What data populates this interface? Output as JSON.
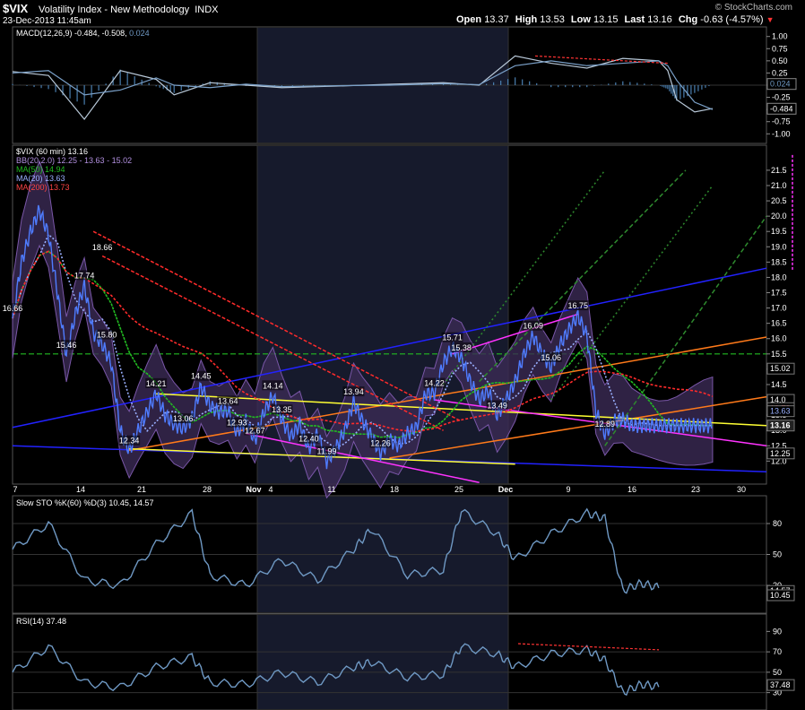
{
  "header": {
    "symbol": "$VIX",
    "name": "Volatility Index - New Methodology",
    "exchange": "INDX",
    "datetime": "23-Dec-2013 11:45am",
    "watermark": "© StockCharts.com",
    "open_label": "Open",
    "open": "13.37",
    "high_label": "High",
    "high": "13.53",
    "low_label": "Low",
    "low": "13.15",
    "last_label": "Last",
    "last": "13.16",
    "chg_label": "Chg",
    "chg": "-0.63 (-4.57%)",
    "chg_arrow": "▼"
  },
  "colors": {
    "background": "#000000",
    "price": "#4f7cff",
    "bb": "#7a57a8",
    "ma50": "#22bb22",
    "ma20": "#9ab0ff",
    "ma200": "#ff2b2b",
    "trend_blue": "#2222ff",
    "trend_orange": "#ff7a1a",
    "trend_yellow": "#ffff33",
    "trend_magenta": "#ff33ff",
    "trend_green": "#2e8b2e",
    "indicator": "#6f99c4"
  },
  "chart_data": [
    {
      "type": "line",
      "panel": "macd",
      "title": "MACD(12,26,9)",
      "legend_values": [
        "-0.484",
        "-0.508",
        "0.024"
      ],
      "ytick_labels": [
        "1.00",
        "0.75",
        "0.50",
        "0.25",
        "0.00",
        "-0.25",
        "-0.50",
        "-0.75",
        "-1.00"
      ],
      "ylim": [
        -1.05,
        1.05
      ],
      "current_values": {
        "histogram": 0.024,
        "macd": -0.484
      },
      "series": [
        {
          "role": "macd",
          "x": [
            0,
            4,
            8,
            12,
            16,
            18,
            22,
            26,
            30,
            36,
            42,
            48,
            52,
            56,
            60,
            64,
            68,
            72,
            73,
            74,
            76,
            78
          ],
          "values": [
            0.28,
            0.2,
            -0.7,
            0.3,
            0.12,
            -0.2,
            0.05,
            0.0,
            -0.05,
            -0.02,
            0.02,
            0.05,
            0.0,
            0.6,
            0.45,
            0.35,
            0.55,
            0.5,
            0.3,
            -0.3,
            -0.55,
            -0.48
          ]
        },
        {
          "role": "signal",
          "x": [
            0,
            4,
            8,
            12,
            16,
            18,
            22,
            26,
            30,
            36,
            42,
            48,
            52,
            56,
            60,
            64,
            68,
            72,
            73,
            74,
            76,
            78
          ],
          "values": [
            0.25,
            0.3,
            -0.2,
            -0.1,
            0.15,
            0.0,
            -0.05,
            0.02,
            -0.03,
            -0.01,
            0.0,
            0.03,
            0.01,
            0.4,
            0.5,
            0.4,
            0.45,
            0.5,
            0.4,
            0.1,
            -0.35,
            -0.5
          ]
        }
      ]
    },
    {
      "type": "line",
      "panel": "price",
      "title": "$VIX (60 min) 13.16",
      "legend": [
        {
          "label": "BB(20,2.0) 12.25 - 13.63 - 15.02"
        },
        {
          "label": "MA(50) 14.94"
        },
        {
          "label": "MA(20) 13.63"
        },
        {
          "label": "MA(200) 13.73"
        }
      ],
      "ytick_labels": [
        "21.5",
        "21.0",
        "20.5",
        "20.0",
        "19.5",
        "19.0",
        "18.5",
        "18.0",
        "17.5",
        "17.0",
        "16.5",
        "16.0",
        "15.5",
        "15.0",
        "14.5",
        "14.0",
        "13.5",
        "13.0",
        "12.5",
        "12.0"
      ],
      "ylim": [
        11.6,
        22.2
      ],
      "right_value_tags": [
        "15.02",
        "14.0",
        "13.73",
        "13.63",
        "13.16",
        "12.25"
      ],
      "xtick_labels": [
        "7",
        "14",
        "21",
        "28",
        "Nov",
        "4",
        "11",
        "18",
        "25",
        "Dec",
        "9",
        "16",
        "23",
        "30"
      ],
      "x": [
        0,
        1,
        2,
        3,
        4,
        5,
        6,
        7,
        8,
        9,
        10,
        11,
        12,
        13,
        14,
        15,
        16,
        17,
        18,
        19,
        20,
        21,
        22,
        23,
        24,
        25,
        26,
        27,
        28,
        29,
        30,
        31,
        32,
        33,
        34,
        35,
        36,
        37,
        38,
        39,
        40,
        41,
        42,
        43,
        44,
        45,
        46,
        47,
        48,
        49,
        50,
        51,
        52,
        53,
        54,
        55,
        56,
        57,
        58,
        59,
        60,
        61,
        62,
        63,
        64,
        65,
        66,
        67,
        68,
        69,
        70,
        71,
        72,
        73,
        74,
        75,
        76,
        77,
        78
      ],
      "values": [
        16.66,
        18.5,
        19.5,
        20.2,
        19.4,
        17.5,
        15.46,
        16.8,
        17.74,
        16.2,
        15.8,
        15.2,
        13.0,
        12.34,
        13.0,
        13.6,
        14.21,
        13.5,
        13.2,
        13.06,
        13.4,
        14.45,
        13.8,
        13.6,
        13.64,
        12.93,
        13.3,
        12.67,
        13.6,
        14.14,
        13.35,
        12.8,
        13.2,
        12.4,
        12.9,
        11.99,
        12.4,
        13.0,
        13.94,
        13.3,
        12.8,
        12.26,
        12.7,
        12.5,
        12.9,
        13.1,
        14.2,
        14.22,
        15.2,
        15.71,
        15.38,
        14.6,
        14.0,
        14.3,
        13.49,
        14.0,
        14.6,
        15.5,
        16.09,
        15.5,
        15.06,
        15.8,
        16.3,
        16.75,
        16.1,
        13.6,
        12.89,
        13.3,
        13.37,
        13.16,
        13.16,
        13.16,
        13.16,
        13.16,
        13.16,
        13.16,
        13.16,
        13.16,
        13.16
      ],
      "x_domain": [
        0,
        84
      ],
      "data_labels": [
        {
          "text": "16.66",
          "x": 0,
          "y": 16.66
        },
        {
          "text": "18.66",
          "x": 10,
          "y": 18.66
        },
        {
          "text": "17.74",
          "x": 8,
          "y": 17.74
        },
        {
          "text": "15.80",
          "x": 10.5,
          "y": 15.8
        },
        {
          "text": "15.46",
          "x": 6,
          "y": 15.46
        },
        {
          "text": "14.21",
          "x": 16,
          "y": 14.21
        },
        {
          "text": "14.45",
          "x": 21,
          "y": 14.45
        },
        {
          "text": "14.14",
          "x": 29,
          "y": 14.14
        },
        {
          "text": "13.94",
          "x": 38,
          "y": 13.94
        },
        {
          "text": "13.64",
          "x": 24,
          "y": 13.64
        },
        {
          "text": "13.35",
          "x": 30,
          "y": 13.35
        },
        {
          "text": "13.06",
          "x": 19,
          "y": 13.06
        },
        {
          "text": "12.93",
          "x": 25,
          "y": 12.93
        },
        {
          "text": "12.67",
          "x": 27,
          "y": 12.67
        },
        {
          "text": "12.40",
          "x": 33,
          "y": 12.4
        },
        {
          "text": "12.34",
          "x": 13,
          "y": 12.34
        },
        {
          "text": "11.99",
          "x": 35,
          "y": 11.99
        },
        {
          "text": "12.26",
          "x": 41,
          "y": 12.26
        },
        {
          "text": "15.71",
          "x": 49,
          "y": 15.71
        },
        {
          "text": "15.38",
          "x": 50,
          "y": 15.38
        },
        {
          "text": "14.22",
          "x": 47,
          "y": 14.22
        },
        {
          "text": "13.49",
          "x": 54,
          "y": 13.49
        },
        {
          "text": "16.09",
          "x": 58,
          "y": 16.09
        },
        {
          "text": "15.06",
          "x": 60,
          "y": 15.06
        },
        {
          "text": "16.75",
          "x": 63,
          "y": 16.75
        },
        {
          "text": "12.89",
          "x": 66,
          "y": 12.89
        }
      ],
      "reference_lines": [
        {
          "value": 15.5,
          "style": "dashed",
          "color": "#22bb22"
        }
      ]
    },
    {
      "type": "line",
      "panel": "stochastic",
      "title": "Slow STO %K(60) %D(3)",
      "legend_values": [
        "10.45",
        "14.57"
      ],
      "ytick_labels": [
        "80",
        "50",
        "20"
      ],
      "ylim": [
        0,
        100
      ],
      "right_value_tags": [
        "14.57",
        "10.45"
      ],
      "x": [
        0,
        4,
        8,
        12,
        16,
        20,
        22,
        26,
        30,
        34,
        38,
        40,
        44,
        48,
        50,
        54,
        56,
        60,
        64,
        66,
        68,
        70,
        72
      ],
      "values": [
        55,
        80,
        25,
        20,
        60,
        90,
        30,
        20,
        45,
        25,
        55,
        75,
        30,
        35,
        92,
        70,
        45,
        70,
        90,
        85,
        15,
        22,
        18
      ]
    },
    {
      "type": "line",
      "panel": "rsi",
      "title": "RSI(14)",
      "legend_values": [
        "37.48"
      ],
      "ytick_labels": [
        "90",
        "70",
        "50",
        "30"
      ],
      "ylim": [
        20,
        100
      ],
      "right_value_tags": [
        "37.48"
      ],
      "x": [
        0,
        4,
        8,
        12,
        16,
        20,
        22,
        26,
        30,
        34,
        38,
        40,
        44,
        48,
        50,
        54,
        56,
        60,
        64,
        66,
        68,
        70,
        72
      ],
      "values": [
        50,
        75,
        40,
        35,
        55,
        65,
        40,
        38,
        50,
        40,
        55,
        60,
        45,
        48,
        75,
        68,
        55,
        68,
        72,
        62,
        30,
        38,
        36
      ]
    }
  ]
}
